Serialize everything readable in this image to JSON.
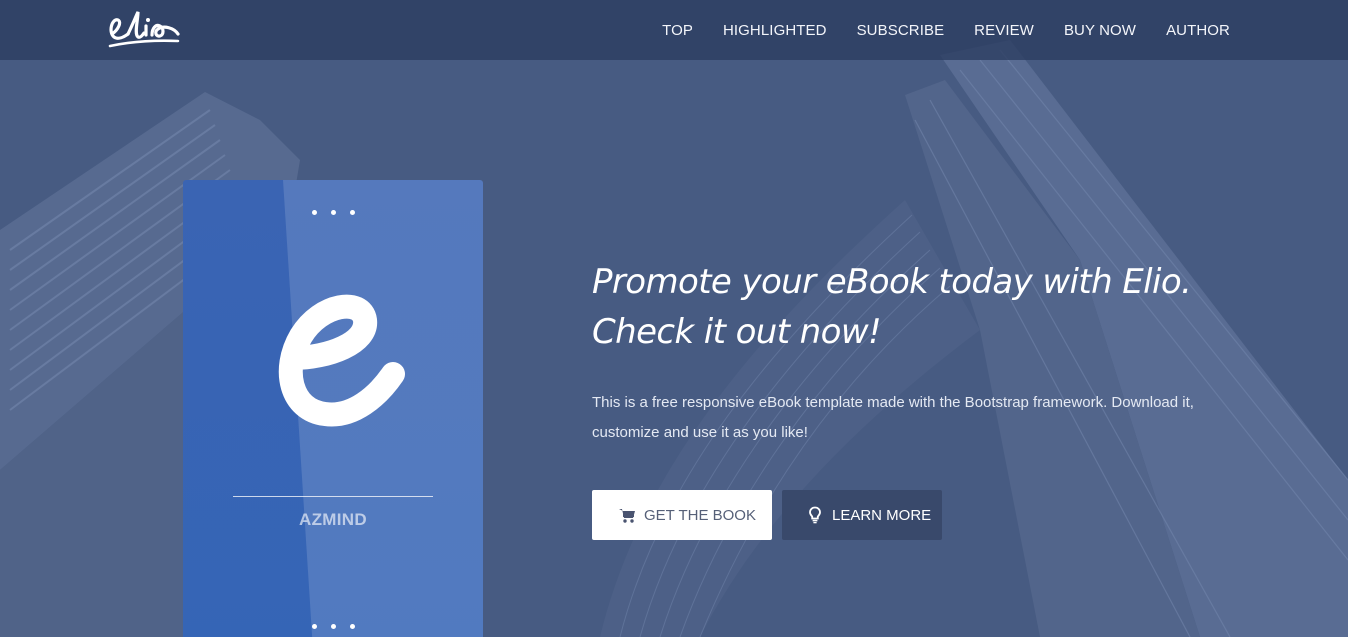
{
  "brand": {
    "logo_text": "elio"
  },
  "nav": {
    "items": [
      {
        "label": "TOP"
      },
      {
        "label": "HIGHLIGHTED"
      },
      {
        "label": "SUBSCRIBE"
      },
      {
        "label": "REVIEW"
      },
      {
        "label": "BUY NOW"
      },
      {
        "label": "AUTHOR"
      }
    ]
  },
  "book": {
    "letter": "e",
    "author": "AZMIND"
  },
  "hero": {
    "headline_line1": "Promote your eBook today with Elio.",
    "headline_line2": "Check it out now!",
    "description_line1": "This is a free responsive eBook template made with the Bootstrap framework. Download it,",
    "description_line2": "customize and use it as you like!",
    "primary_button": {
      "label": "GET THE BOOK",
      "icon": "cart-icon"
    },
    "secondary_button": {
      "label": "LEARN MORE",
      "icon": "lightbulb-icon"
    }
  },
  "colors": {
    "hero_overlay": "#44587f",
    "navbar": "#2c3c60",
    "book_cover": "#3565b6",
    "secondary_button": "#39496b"
  }
}
